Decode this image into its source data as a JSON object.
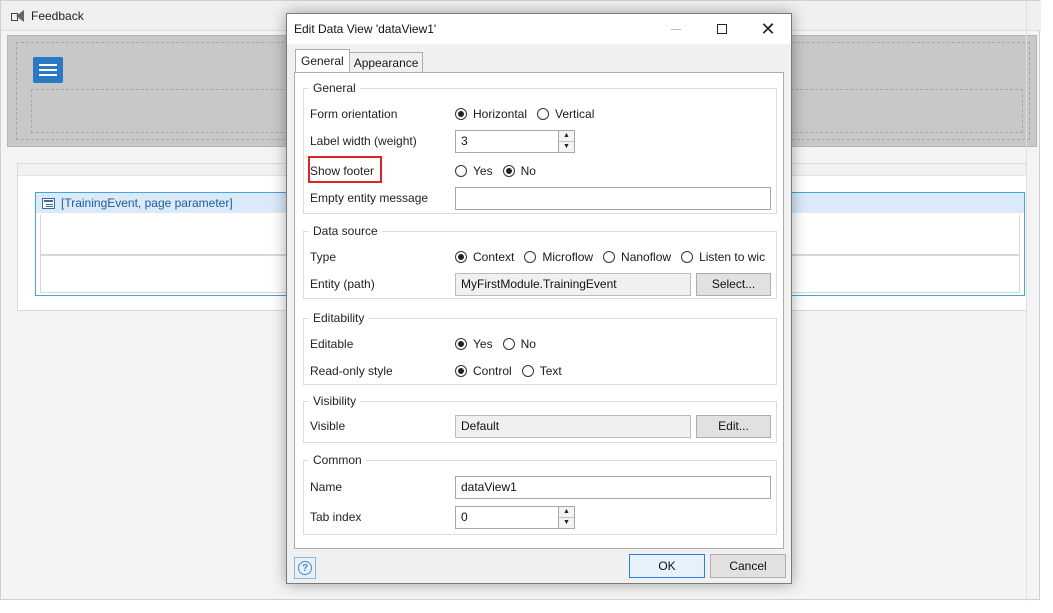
{
  "background": {
    "toolbar_label": "Feedback",
    "dataview_label": "[TrainingEvent, page parameter]"
  },
  "dialog": {
    "title": "Edit Data View 'dataView1'",
    "tabs": [
      "General",
      "Appearance"
    ],
    "general_group": {
      "title": "General",
      "form_orientation": {
        "label": "Form orientation",
        "options": [
          "Horizontal",
          "Vertical"
        ],
        "selected": "Horizontal"
      },
      "label_width": {
        "label": "Label width (weight)",
        "value": "3"
      },
      "show_footer": {
        "label": "Show footer",
        "options": [
          "Yes",
          "No"
        ],
        "selected": "No"
      },
      "empty_entity_message": {
        "label": "Empty entity message",
        "value": ""
      }
    },
    "data_source_group": {
      "title": "Data source",
      "type": {
        "label": "Type",
        "options": [
          "Context",
          "Microflow",
          "Nanoflow",
          "Listen to wic"
        ],
        "selected": "Context"
      },
      "entity": {
        "label": "Entity (path)",
        "value": "MyFirstModule.TrainingEvent",
        "button": "Select..."
      }
    },
    "editability_group": {
      "title": "Editability",
      "editable": {
        "label": "Editable",
        "options": [
          "Yes",
          "No"
        ],
        "selected": "Yes"
      },
      "read_only_style": {
        "label": "Read-only style",
        "options": [
          "Control",
          "Text"
        ],
        "selected": "Control"
      }
    },
    "visibility_group": {
      "title": "Visibility",
      "visible": {
        "label": "Visible",
        "value": "Default",
        "button": "Edit..."
      }
    },
    "common_group": {
      "title": "Common",
      "name": {
        "label": "Name",
        "value": "dataView1"
      },
      "tab_index": {
        "label": "Tab index",
        "value": "0"
      }
    },
    "ok_label": "OK",
    "cancel_label": "Cancel"
  },
  "colors": {
    "accent": "#2a79c6",
    "highlight_box": "#e02323",
    "dataview_border": "#44a5d8"
  },
  "icons": [
    "megaphone-icon",
    "hamburger-menu-icon",
    "data-view-icon",
    "minimize-icon",
    "maximize-icon",
    "close-icon",
    "help-icon",
    "spinner-up-icon",
    "spinner-down-icon"
  ]
}
